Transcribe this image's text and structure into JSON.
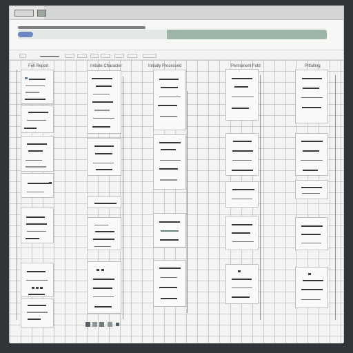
{
  "window": {
    "title": "",
    "colors": {
      "window_bg": "#f3f3f2",
      "accent_blue": "#6c87c0",
      "accent_green": "#9db5a7",
      "frame_dark": "#2f3538"
    }
  },
  "toolbar": {
    "search_placeholder": "",
    "primary_button_icon": "window-button-icon",
    "secondary_button_icon": "window-button-icon"
  },
  "columns": [
    {
      "heading": "Fell Report"
    },
    {
      "heading": "Initiate Character"
    },
    {
      "heading": "Initially Processed"
    },
    {
      "heading": "Permanent Fold"
    },
    {
      "heading": "Pitfalling"
    }
  ],
  "status": {
    "icons": [
      "status-icon",
      "status-icon",
      "status-icon",
      "status-icon",
      "status-icon"
    ]
  }
}
